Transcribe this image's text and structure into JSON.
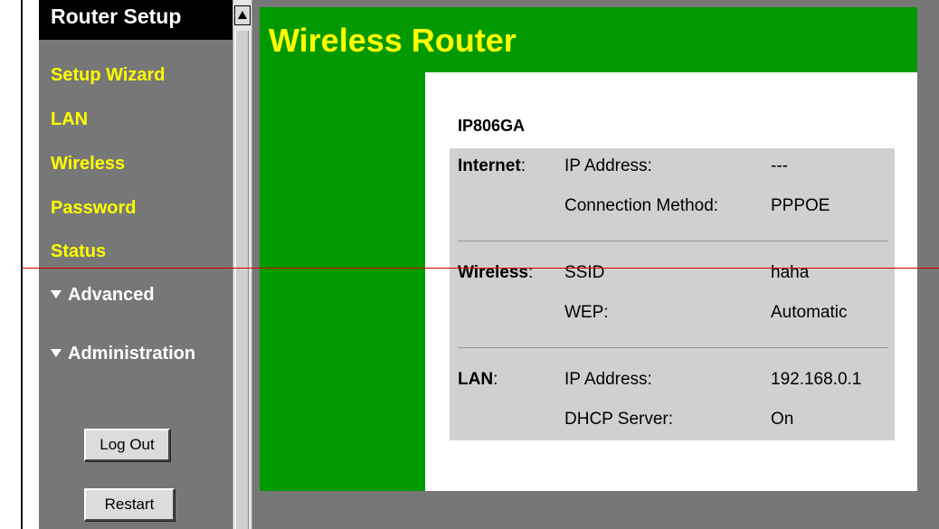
{
  "sidebar": {
    "title": "Router Setup",
    "items": [
      {
        "label": "Setup Wizard"
      },
      {
        "label": "LAN"
      },
      {
        "label": "Wireless"
      },
      {
        "label": "Password"
      },
      {
        "label": "Status"
      }
    ],
    "sections": [
      {
        "label": "Advanced"
      },
      {
        "label": "Administration"
      }
    ],
    "buttons": {
      "logout": "Log Out",
      "restart": "Restart"
    }
  },
  "main": {
    "title": "Wireless Router",
    "model": "IP806GA",
    "internet": {
      "label": "Internet",
      "colon": ":",
      "ip_key": "IP Address:",
      "ip_value": "---",
      "method_key": "Connection Method:",
      "method_value": "PPPOE"
    },
    "wireless": {
      "label": "Wireless",
      "colon": ":",
      "ssid_key": "SSID",
      "ssid_value": "haha",
      "wep_key": "WEP:",
      "wep_value": "Automatic"
    },
    "lan": {
      "label": "LAN",
      "colon": ":",
      "ip_key": "IP Address:",
      "ip_value": "192.168.0.1",
      "dhcp_key": "DHCP Server:",
      "dhcp_value": "On"
    }
  },
  "colors": {
    "sidebar_bg": "#777777",
    "menu_text": "#ffff00",
    "header_bg": "#000000",
    "content_green": "#009900",
    "status_box": "#d0d0d0",
    "overlay_line": "#dd0000"
  }
}
